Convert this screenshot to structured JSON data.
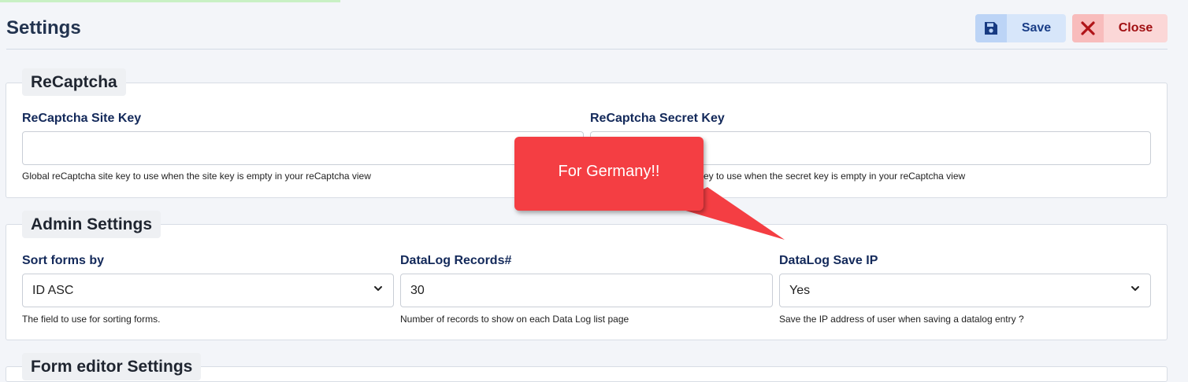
{
  "header": {
    "title": "Settings",
    "save_label": "Save",
    "close_label": "Close",
    "save_icon": "floppy-disk-icon",
    "close_icon": "x-mark-icon",
    "save_accent": "#1a3e87",
    "close_accent": "#a10f12"
  },
  "recaptcha": {
    "legend": "ReCaptcha",
    "site_key": {
      "label": "ReCaptcha Site Key",
      "value": "",
      "help": "Global reCaptcha site key to use when the site key is empty in your reCaptcha view"
    },
    "secret_key": {
      "label": "ReCaptcha Secret Key",
      "value": "",
      "help": "key to use when the secret key is empty in your reCaptcha view"
    }
  },
  "admin": {
    "legend": "Admin Settings",
    "sort_forms": {
      "label": "Sort forms by",
      "value": "ID ASC",
      "help": "The field to use for sorting forms."
    },
    "datalog_records": {
      "label": "DataLog Records#",
      "value": "30",
      "help": "Number of records to show on each Data Log list page"
    },
    "datalog_save_ip": {
      "label": "DataLog Save IP",
      "value": "Yes",
      "help": "Save the IP address of user when saving a datalog entry ?"
    }
  },
  "form_editor": {
    "legend": "Form editor Settings"
  },
  "annotation": {
    "text": "For Germany!!",
    "color": "#f43e43"
  }
}
